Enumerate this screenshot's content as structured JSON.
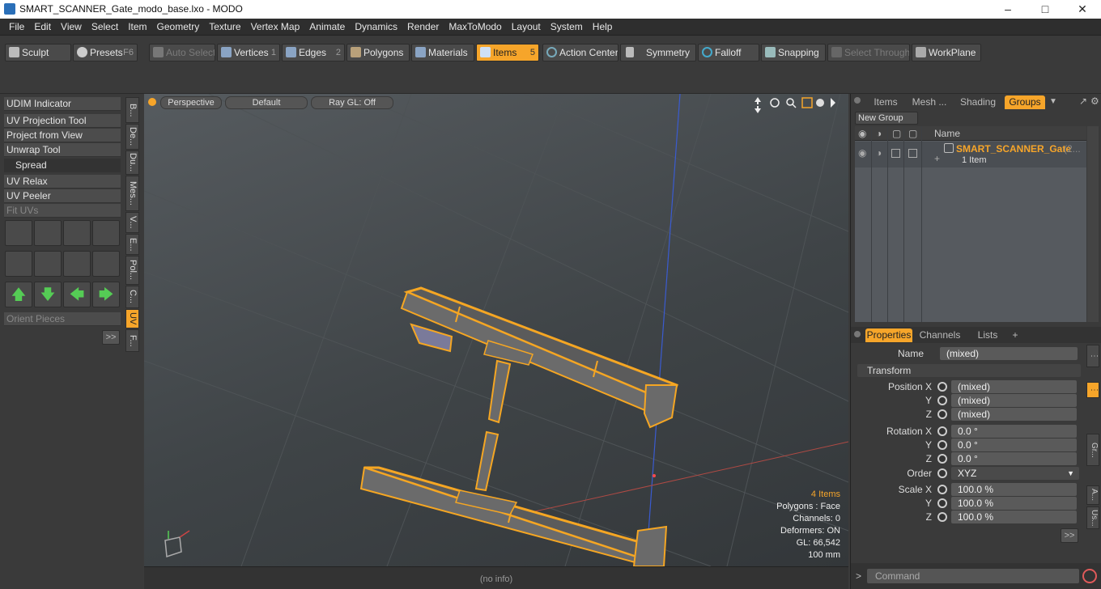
{
  "window": {
    "title": "SMART_SCANNER_Gate_modo_base.lxo - MODO"
  },
  "menu": [
    "File",
    "Edit",
    "View",
    "Select",
    "Item",
    "Geometry",
    "Texture",
    "Vertex Map",
    "Animate",
    "Dynamics",
    "Render",
    "MaxToModo",
    "Layout",
    "System",
    "Help"
  ],
  "toolbar": {
    "sculpt": "Sculpt",
    "presets": "Presets",
    "presets_key": "F6",
    "auto_select": "Auto Select",
    "vertices": "Vertices",
    "vertices_key": "1",
    "edges": "Edges",
    "edges_key": "2",
    "polygons": "Polygons",
    "materials": "Materials",
    "items": "Items",
    "items_key": "5",
    "action_center": "Action Center",
    "symmetry": "Symmetry",
    "falloff": "Falloff",
    "snapping": "Snapping",
    "select_through": "Select Through",
    "workplane": "WorkPlane"
  },
  "left": {
    "udim": "UDIM Indicator",
    "uv_projection": "UV Projection Tool",
    "project_view": "Project from View",
    "unwrap": "Unwrap Tool",
    "spread": "Spread",
    "uv_relax": "UV Relax",
    "uv_peeler": "UV Peeler",
    "fit_uvs": "Fit UVs",
    "orient": "Orient Pieces",
    "more": ">>",
    "vtabs": [
      "B...",
      "De...",
      "Du...",
      "Mes...",
      "V...",
      "E...",
      "Pol...",
      "C...",
      "UV",
      "F..."
    ]
  },
  "viewport": {
    "perspective": "Perspective",
    "default": "Default",
    "raygl": "Ray GL: Off",
    "stats": {
      "items": "4 Items",
      "polygons": "Polygons : Face",
      "channels": "Channels: 0",
      "deformers": "Deformers: ON",
      "gl": "GL: 66,542",
      "unit": "100 mm"
    }
  },
  "status": {
    "info": "(no info)"
  },
  "right": {
    "tabs": [
      "Items",
      "Mesh ...",
      "Shading",
      "Groups"
    ],
    "new_group": "New Group",
    "name_col": "Name",
    "group_name": "SMART_SCANNER_Gate",
    "group_count": "(2...",
    "group_sub": "1 Item",
    "prop_tabs": [
      "Properties",
      "Channels",
      "Lists",
      "+"
    ],
    "name_label": "Name",
    "name_value": "(mixed)",
    "transform": "Transform",
    "position_x_label": "Position X",
    "y_label": "Y",
    "z_label": "Z",
    "pos_x": "(mixed)",
    "pos_y": "(mixed)",
    "pos_z": "(mixed)",
    "rotation_x_label": "Rotation X",
    "rot_x": "0.0 °",
    "rot_y": "0.0 °",
    "rot_z": "0.0 °",
    "order_label": "Order",
    "order": "XYZ",
    "scale_x_label": "Scale X",
    "scale_x": "100.0 %",
    "scale_y": "100.0 %",
    "scale_z": "100.0 %",
    "more": ">>",
    "command": "Command",
    "side_tabs": [
      "Gr...",
      "A...",
      "Us..."
    ]
  },
  "colors": {
    "accent": "#f6a52a",
    "wire": "#f5a623"
  }
}
